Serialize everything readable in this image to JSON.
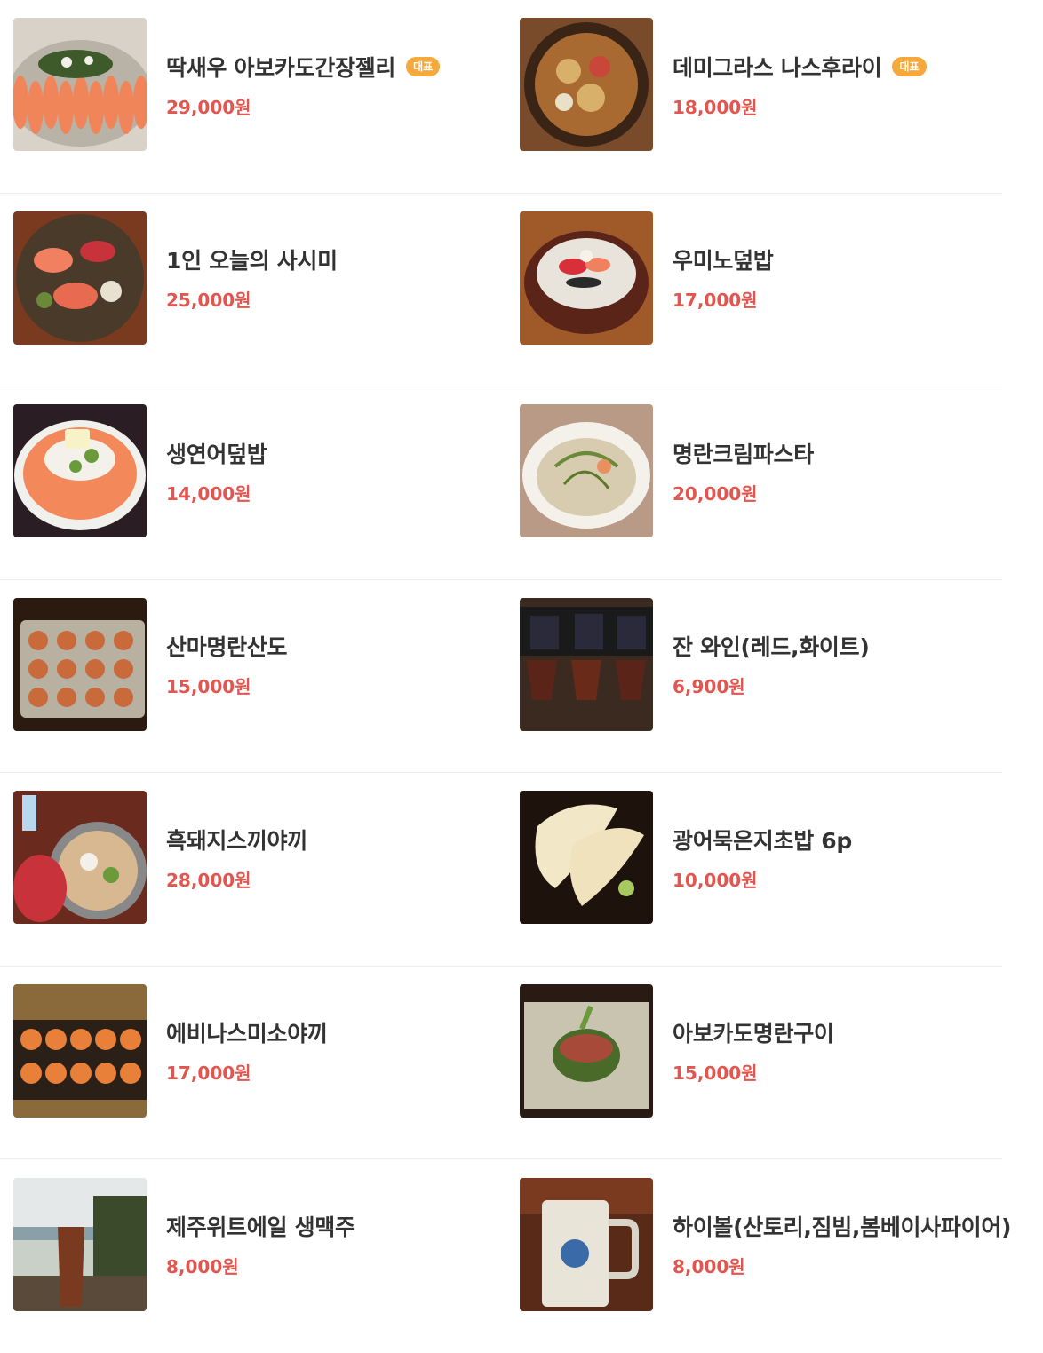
{
  "menu": {
    "rows": [
      [
        {
          "name": "딱새우 아보카도간장젤리",
          "badge": "대표",
          "price": "29,000원",
          "image": "shrimp-platter"
        },
        {
          "name": "데미그라스 나스후라이",
          "badge": "대표",
          "price": "18,000원",
          "image": "eggplant-fry"
        }
      ],
      [
        {
          "name": "1인 오늘의 사시미",
          "badge": "",
          "price": "25,000원",
          "image": "sashimi-plate"
        },
        {
          "name": "우미노덮밥",
          "badge": "",
          "price": "17,000원",
          "image": "seafood-bowl"
        }
      ],
      [
        {
          "name": "생연어덮밥",
          "badge": "",
          "price": "14,000원",
          "image": "salmon-bowl"
        },
        {
          "name": "명란크림파스타",
          "badge": "",
          "price": "20,000원",
          "image": "cream-pasta"
        }
      ],
      [
        {
          "name": "산마명란산도",
          "badge": "",
          "price": "15,000원",
          "image": "yam-sando"
        },
        {
          "name": "잔 와인(레드,화이트)",
          "badge": "",
          "price": "6,900원",
          "image": "wine-glasses"
        }
      ],
      [
        {
          "name": "흑돼지스끼야끼",
          "badge": "",
          "price": "28,000원",
          "image": "sukiyaki-set"
        },
        {
          "name": "광어묵은지초밥 6p",
          "badge": "",
          "price": "10,000원",
          "image": "flatfish-sushi"
        }
      ],
      [
        {
          "name": "에비나스미소야끼",
          "badge": "",
          "price": "17,000원",
          "image": "miso-yaki"
        },
        {
          "name": "아보카도명란구이",
          "badge": "",
          "price": "15,000원",
          "image": "avocado-grill"
        }
      ],
      [
        {
          "name": "제주위트에일 생맥주",
          "badge": "",
          "price": "8,000원",
          "image": "draft-beer"
        },
        {
          "name": "하이볼(산토리,짐빔,봄베이사파이어)",
          "badge": "",
          "price": "8,000원",
          "image": "highball-mug"
        }
      ]
    ]
  },
  "colors": {
    "price": "#e2564f",
    "badge": "#f5a83c",
    "divider": "#ececec"
  }
}
